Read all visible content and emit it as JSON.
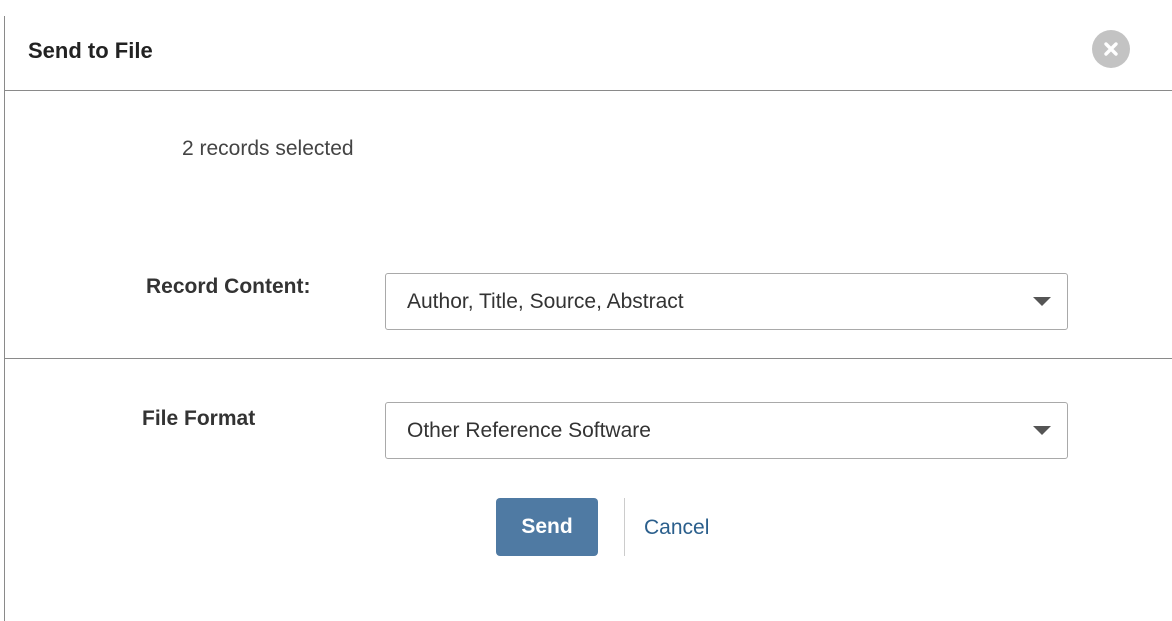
{
  "dialog": {
    "title": "Send to File",
    "close_icon": "close-icon",
    "records_selected": "2 records selected",
    "record_content": {
      "label": "Record Content:",
      "value": "Author, Title, Source, Abstract"
    },
    "file_format": {
      "label": "File Format",
      "value": "Other Reference Software"
    },
    "send_label": "Send",
    "cancel_label": "Cancel"
  },
  "colors": {
    "send_button": "#4f7aa3",
    "cancel_link": "#2b5f8c",
    "close_button": "#c3c3c3"
  }
}
